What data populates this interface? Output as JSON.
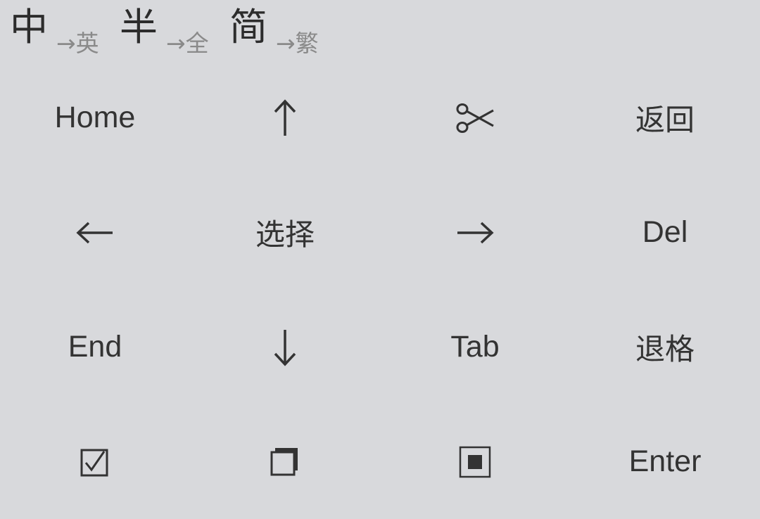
{
  "mode_toggles": [
    {
      "id": "lang",
      "main": "中",
      "arrow_to": "→英"
    },
    {
      "id": "width",
      "main": "半",
      "arrow_to": "→全"
    },
    {
      "id": "script",
      "main": "简",
      "arrow_to": "→繁"
    }
  ],
  "keys": {
    "home": "Home",
    "up": "up-arrow-icon",
    "cut": "scissors-icon",
    "back": "返回",
    "left": "left-arrow-icon",
    "select": "选择",
    "right": "right-arrow-icon",
    "del": "Del",
    "end": "End",
    "down": "down-arrow-icon",
    "tab": "Tab",
    "backspace": "退格",
    "select_all": "checkbox-icon",
    "copy": "copy-icon",
    "paste": "paste-icon",
    "enter": "Enter"
  },
  "colors": {
    "background": "#d8d9dc",
    "text": "#333333",
    "secondary_text": "#8a8a8a"
  }
}
